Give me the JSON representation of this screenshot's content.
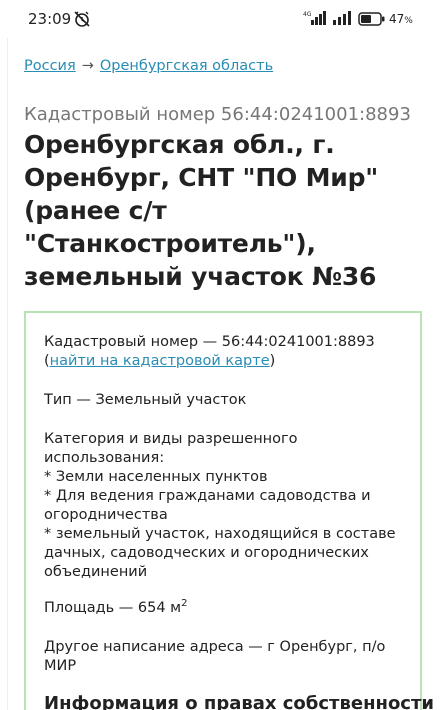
{
  "status": {
    "time": "23:09",
    "network": "4G",
    "battery": "47",
    "battery_unit": "%"
  },
  "breadcrumb": {
    "items": [
      "Россия",
      "Оренбургская область"
    ],
    "separator": "→"
  },
  "header": {
    "subtitle": "Кадастровый номер 56:44:0241001:8893",
    "title": "Оренбургская обл., г. Оренбург, СНТ \"ПО Мир\" (ранее с/т \"Станкостроитель\"), земельный участок №36"
  },
  "card": {
    "cadastral_line": "Кадастровый номер — 56:44:0241001:8893",
    "map_link_open": "(",
    "map_link": "найти на кадастровой карте",
    "map_link_close": ")",
    "type_line": "Тип — Земельный участок",
    "category_heading": "Категория и виды разрешенного использования:",
    "category_items": [
      "* Земли населенных пунктов",
      "* Для ведения гражданами садоводства и огородничества",
      "* земельный участок, находящийся в составе дачных, садоводческих и огороднических объединений"
    ],
    "area_label": "Площадь — 654 м",
    "area_sup": "2",
    "alt_address": "Другое написание адреса — г Оренбург, п/о МИР",
    "ownership_heading": "Информация о правах собственности"
  },
  "colors": {
    "link": "#2a8db5",
    "card_border": "#b9e2b5",
    "text": "#222222",
    "muted": "#777777"
  }
}
